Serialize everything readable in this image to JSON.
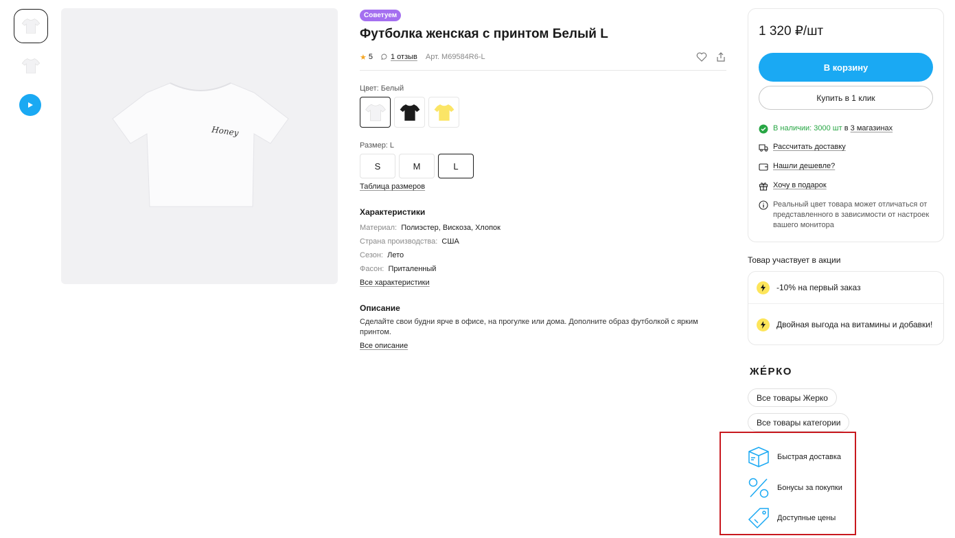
{
  "product": {
    "badge": "Советуем",
    "title": "Футболка женская с принтом Белый L",
    "rating": "5",
    "reviews": "1 отзыв",
    "article": "Арт. М69584R6-L",
    "image_print": "Honey"
  },
  "color": {
    "label": "Цвет: Белый",
    "options": [
      {
        "name": "white",
        "hex": "#f3f3f5"
      },
      {
        "name": "black",
        "hex": "#1c1c1c"
      },
      {
        "name": "yellow",
        "hex": "#fbe566"
      }
    ]
  },
  "size": {
    "label": "Размер: L",
    "options": [
      "S",
      "M",
      "L"
    ],
    "selected": "L",
    "table_link": "Таблица размеров"
  },
  "characteristics": {
    "title": "Характеристики",
    "rows": [
      {
        "key": "Материал:",
        "value": "Полиэстер, Вискоза, Хлопок"
      },
      {
        "key": "Страна производства:",
        "value": "США"
      },
      {
        "key": "Сезон:",
        "value": "Лето"
      },
      {
        "key": "Фасон:",
        "value": "Приталенный"
      }
    ],
    "all_link": "Все характеристики"
  },
  "description": {
    "title": "Описание",
    "text": "Сделайте свои будни ярче в офисе, на прогулке или дома. Дополните образ футболкой с ярким принтом.",
    "all_link": "Все описание"
  },
  "buy": {
    "price": "1 320 ₽/шт",
    "cart_button": "В корзину",
    "one_click_button": "Купить в 1 клик",
    "stock_prefix": "В наличии: 3000 шт",
    "stock_suffix": " в ",
    "stock_link": "3 магазинах",
    "delivery_link": "Рассчитать доставку",
    "cheaper_link": "Нашли дешевле?",
    "gift_link": "Хочу в подарок",
    "color_note": "Реальный цвет товара может отличаться от представленного в зависимости от настроек вашего монитора",
    "accent_color": "#1aa9f3",
    "stock_color": "#27a644"
  },
  "promo": {
    "title": "Товар участвует в акции",
    "items": [
      "-10% на первый заказ",
      "Двойная выгода на витамины и добавки!"
    ]
  },
  "brand": {
    "name": "ЖЕ́РКО",
    "all_brand": "Все товары Жерко",
    "all_category": "Все товары категории"
  },
  "features": {
    "items": [
      "Быстрая доставка",
      "Бонусы за покупки",
      "Доступные цены"
    ],
    "highlight_color": "#c8181e"
  }
}
